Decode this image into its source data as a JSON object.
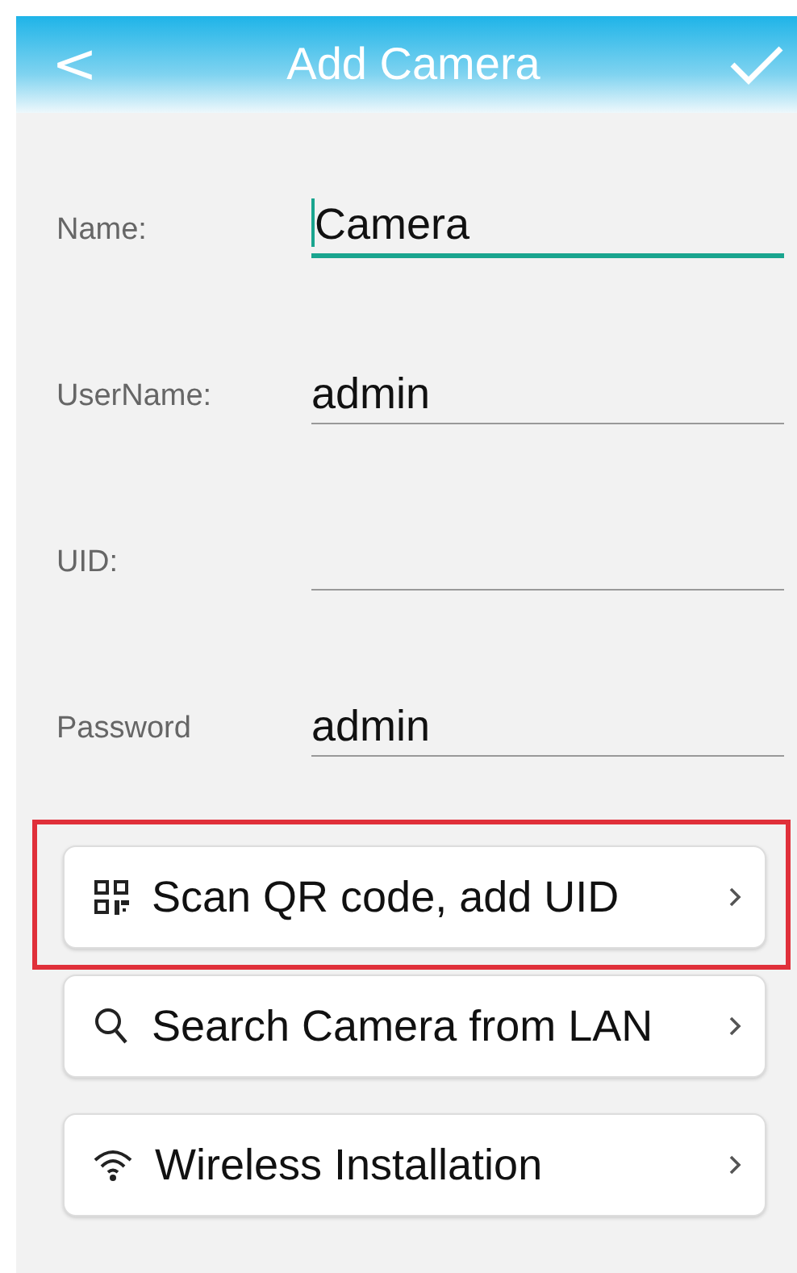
{
  "header": {
    "title": "Add Camera",
    "back": "<"
  },
  "fields": [
    {
      "label": "Name:",
      "value": "Camera",
      "focused": true
    },
    {
      "label": "UserName:",
      "value": "admin",
      "focused": false
    },
    {
      "label": "UID:",
      "focused": false
    },
    {
      "label": "Password",
      "value": "admin",
      "focused": false
    }
  ],
  "actions": [
    {
      "kind": "qr",
      "label": "Scan QR code, add UID",
      "highlighted": true
    },
    {
      "kind": "search",
      "label": "Search Camera from LAN",
      "highlighted": false
    },
    {
      "kind": "wifi",
      "label": "Wireless Installation",
      "highlighted": false
    }
  ]
}
